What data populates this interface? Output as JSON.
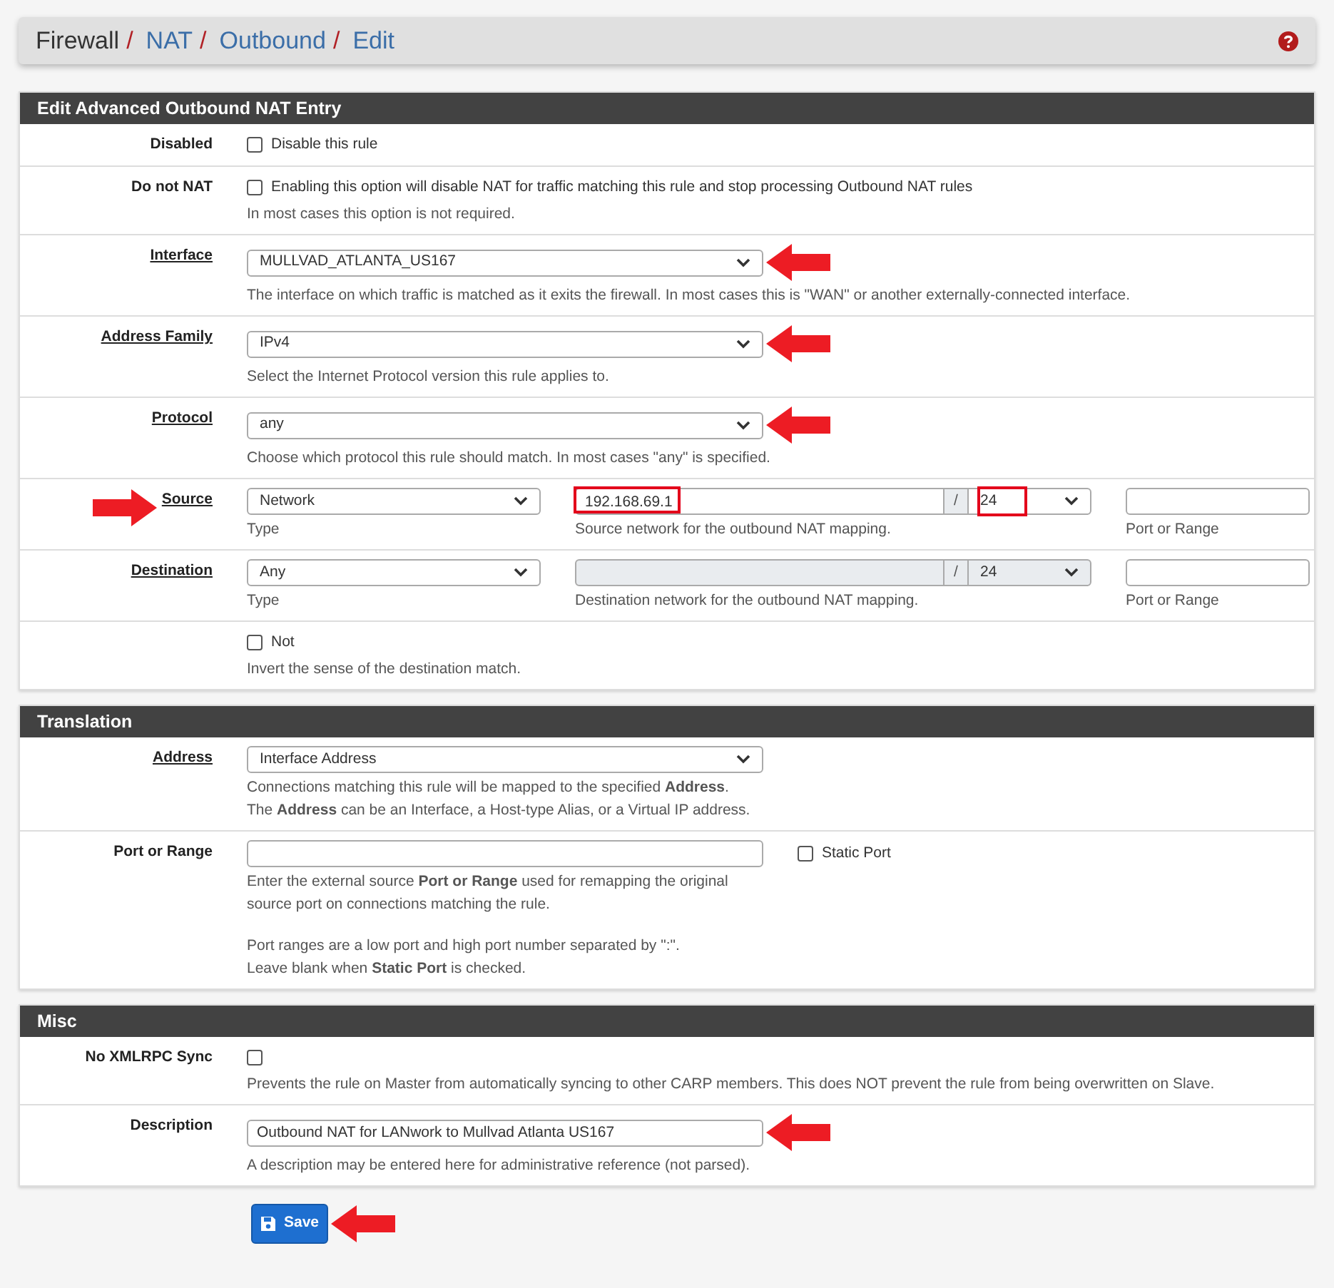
{
  "breadcrumb": [
    {
      "text": "Firewall",
      "link": false,
      "separator": "/"
    },
    {
      "text": "NAT",
      "link": true,
      "separator": "/"
    },
    {
      "text": "Outbound",
      "link": true,
      "separator": "/"
    },
    {
      "text": "Edit",
      "link": true
    }
  ],
  "sections": [
    {
      "title": "Edit Advanced Outbound NAT Entry",
      "rows": [
        {
          "kind": "checkbox",
          "label": "Disabled",
          "checked": false,
          "text": "Disable this rule"
        },
        {
          "kind": "checkbox",
          "label": "Do not NAT",
          "checked": false,
          "text": "Enabling this option will disable NAT for traffic matching this rule and stop processing Outbound NAT rules",
          "help": [
            [
              "In most cases this option is not required."
            ]
          ]
        },
        {
          "kind": "select",
          "label": "Interface",
          "underlined": true,
          "value": "MULLVAD_ATLANTA_US167",
          "arrow_after": true,
          "help": [
            [
              "The interface on which traffic is matched as it exits the firewall. In most cases this is \"WAN\" or another externally-connected interface."
            ]
          ]
        },
        {
          "kind": "select",
          "label": "Address Family",
          "underlined": true,
          "value": "IPv4",
          "arrow_after": true,
          "help": [
            [
              "Select the Internet Protocol version this rule applies to."
            ]
          ]
        },
        {
          "kind": "select",
          "label": "Protocol",
          "underlined": true,
          "value": "any",
          "arrow_after": true,
          "help": [
            [
              "Choose which protocol this rule should match. In most cases \"any\" is specified."
            ]
          ]
        },
        {
          "kind": "address",
          "label": "Source",
          "underlined": true,
          "arrow_before": true,
          "type": "Network",
          "type_help": "Type",
          "network": "192.168.69.1",
          "network_disabled": false,
          "separator": "/",
          "mask": "24",
          "highlighted": true,
          "network_help": "Source network for the outbound NAT mapping.",
          "port_help": "Port or Range"
        },
        {
          "kind": "address",
          "label": "Destination",
          "underlined": true,
          "type": "Any",
          "type_help": "Type",
          "network_disabled": true,
          "separator": "/",
          "mask": "24",
          "highlighted": false,
          "network_help": "Destination network for the outbound NAT mapping.",
          "port_help": "Port or Range"
        },
        {
          "kind": "checkbox",
          "checked": false,
          "text": "Not",
          "help": [
            [
              "Invert the sense of the destination match."
            ]
          ]
        }
      ]
    },
    {
      "title": "Translation",
      "rows": [
        {
          "kind": "select",
          "label": "Address",
          "underlined": true,
          "value": "Interface Address",
          "help": [
            [
              "Connections matching this rule will be mapped to the specified **Address**.",
              "The **Address** can be an Interface, a Host-type Alias, or a Virtual IP address."
            ]
          ]
        },
        {
          "kind": "text",
          "label": "Port or Range",
          "checked": false,
          "side_checkbox": "Static Port",
          "help": [
            [
              "Enter the external source **Port or Range** used for remapping the original",
              "source port on connections matching the rule."
            ],
            [
              "Port ranges are a low port and high port number separated by \":\".",
              "Leave blank when **Static Port** is checked."
            ]
          ]
        }
      ]
    },
    {
      "title": "Misc",
      "rows": [
        {
          "kind": "checkbox",
          "label": "No XMLRPC Sync",
          "checked": false,
          "help": [
            [
              "Prevents the rule on Master from automatically syncing to other CARP members. This does NOT prevent the rule from being overwritten on Slave."
            ]
          ]
        },
        {
          "kind": "text",
          "label": "Description",
          "value": "Outbound NAT for LANwork to Mullvad Atlanta US167",
          "arrow_after": true,
          "help": [
            [
              "A description may be entered here for administrative reference (not parsed)."
            ]
          ]
        }
      ]
    }
  ],
  "save": {
    "label": "Save",
    "arrow_after": true
  }
}
